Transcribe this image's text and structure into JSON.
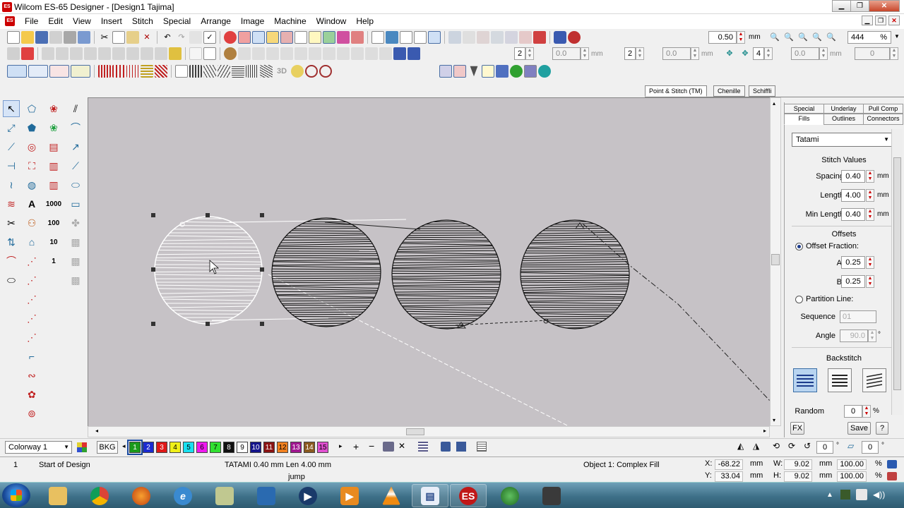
{
  "window": {
    "title": "Wilcom ES-65 Designer - [Design1        Tajima]",
    "app_badge": "ES"
  },
  "menu": [
    "File",
    "Edit",
    "View",
    "Insert",
    "Stitch",
    "Special",
    "Arrange",
    "Image",
    "Machine",
    "Window",
    "Help"
  ],
  "toolbar": {
    "step_value": "0.50",
    "step_unit": "mm",
    "zoom": "444",
    "zoom_unit": "%",
    "count_a": "2",
    "value_a": "0.0",
    "unit_a": "mm",
    "count_b": "2",
    "value_b": "0.0",
    "unit_b": "mm",
    "count_c": "4",
    "value_c": "0.0",
    "unit_c": "mm",
    "value_d": "0",
    "label_3d": "3D"
  },
  "left_tools": {
    "count_1000": "1000",
    "count_100": "100",
    "count_10": "10",
    "count_1": "1"
  },
  "doc_tabs": [
    "Point & Stitch (TM)",
    "Chenille",
    "Schiffli"
  ],
  "panel": {
    "tabs_top": [
      "Special",
      "Underlay",
      "Pull Comp"
    ],
    "tabs_bottom": [
      "Fills",
      "Outlines",
      "Connectors"
    ],
    "active_tab": "Fills",
    "fill_type": "Tatami",
    "stitch_values_heading": "Stitch Values",
    "spacing": {
      "label": "Spacing",
      "value": "0.40",
      "unit": "mm"
    },
    "length": {
      "label": "Length",
      "value": "4.00",
      "unit": "mm"
    },
    "min_length": {
      "label": "Min Length",
      "value": "0.40",
      "unit": "mm"
    },
    "offsets_heading": "Offsets",
    "offset_fraction": {
      "label": "Offset Fraction:",
      "selected": true
    },
    "a": {
      "label": "A:",
      "value": "0.25"
    },
    "b": {
      "label": "B:",
      "value": "0.25"
    },
    "partition_line": {
      "label": "Partition Line:",
      "selected": false
    },
    "sequence": {
      "label": "Sequence",
      "value": "01"
    },
    "angle": {
      "label": "Angle",
      "value": "90.0",
      "unit": "°"
    },
    "backstitch_heading": "Backstitch",
    "random": {
      "label": "Random",
      "value": "0",
      "unit": "%"
    },
    "fx_label": "FX",
    "save_label": "Save",
    "help_label": "?"
  },
  "colorbar": {
    "colorway": "Colorway 1",
    "bkg_label": "BKG",
    "swatches": [
      {
        "n": "1",
        "color": "#1a9a1a",
        "text": "#ffffff"
      },
      {
        "n": "2",
        "color": "#1a2ad0",
        "text": "#ffffff"
      },
      {
        "n": "3",
        "color": "#e01818",
        "text": "#ffffff"
      },
      {
        "n": "4",
        "color": "#f0f018",
        "text": "#000000"
      },
      {
        "n": "5",
        "color": "#18e0f0",
        "text": "#000000"
      },
      {
        "n": "6",
        "color": "#f018f0",
        "text": "#000000"
      },
      {
        "n": "7",
        "color": "#30e030",
        "text": "#000000"
      },
      {
        "n": "8",
        "color": "#111111",
        "text": "#ffffff"
      },
      {
        "n": "9",
        "color": "#ffffff",
        "text": "#000000"
      },
      {
        "n": "10",
        "color": "#14148a",
        "text": "#ffffff"
      },
      {
        "n": "11",
        "color": "#8a1414",
        "text": "#ffffff"
      },
      {
        "n": "12",
        "color": "#f08020",
        "text": "#000000"
      },
      {
        "n": "13",
        "color": "#a01890",
        "text": "#ffffff"
      },
      {
        "n": "14",
        "color": "#8a5a20",
        "text": "#ffffff"
      },
      {
        "n": "15",
        "color": "#e050d0",
        "text": "#000000"
      }
    ],
    "rotate_value": "0",
    "rotate_unit": "°",
    "slant_value": "0",
    "slant_unit": "°"
  },
  "status": {
    "stitch_no": "1",
    "stitch_desc": "Start of Design",
    "stitch_info": "TATAMI  0.40 mm Len  4.00 mm",
    "stitch_type": "jump",
    "object": "Object 1: Complex Fill",
    "x_label": "X:",
    "x": "-68.22",
    "y_label": "Y:",
    "y": "33.04",
    "w_label": "W:",
    "w": "9.02",
    "h_label": "H:",
    "h": "9.02",
    "w_pct": "100.00",
    "h_pct": "100.00",
    "unit": "mm",
    "pct": "%"
  }
}
